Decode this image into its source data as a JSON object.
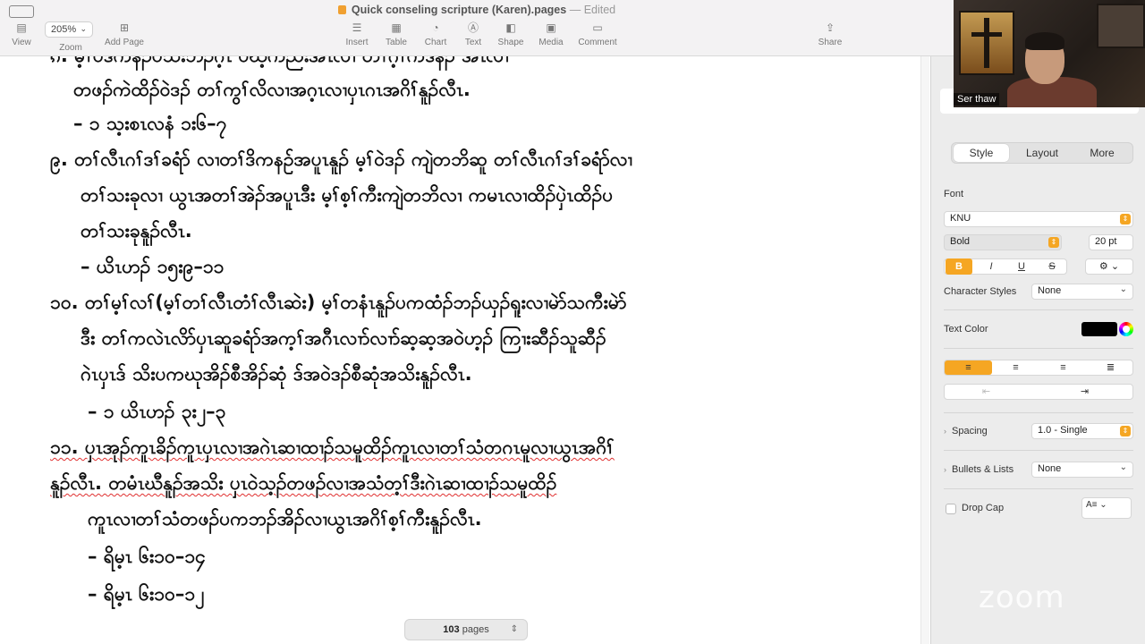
{
  "window": {
    "title": "Quick conseling scripture (Karen).pages",
    "status": "Edited",
    "separator": "—"
  },
  "toolbar": {
    "view_label": "View",
    "zoom_value": "205%",
    "zoom_label": "Zoom",
    "add_page_label": "Add Page",
    "insert_label": "Insert",
    "table_label": "Table",
    "chart_label": "Chart",
    "text_label": "Text",
    "shape_label": "Shape",
    "media_label": "Media",
    "comment_label": "Comment",
    "share_label": "Share"
  },
  "document": {
    "lines": [
      {
        "text": "ၵ. မ့ၢ်ပဒိကနဲၣ်ပသးဘၣ်ဂ့ၤ ပဃ့ကညးအီၤလၢ တၢ်ဂ့ၢ်ကိဒံနဲၣ် အီၤလၢ",
        "squiggle": false
      },
      {
        "text": "တဖၣ်ကဲထိၣ်ဝဲဒၣ် တၢ်ကွၢ်လိလၢအဂ့ၤလၢပှၤဂၤအဂိၢ်နူၣ်လီၤ.",
        "squiggle": false
      },
      {
        "text": "– ၁ သ့းစၤလနံ ၁း၆–၇",
        "squiggle": false
      },
      {
        "text": "၉. တၢ်လီၤဂၢ်ဒၢ်ခရံာ် လၢတၢ်ဒိကနဉ်အပူၤနူၣ် မ့ၢ်ဝဲဒၣ် ကျဲတဘိဆူ တၢ်လီၤဂၢ်ဒၢ်ခရံာ်လၢ",
        "squiggle": false
      },
      {
        "text": "တၢ်သးခုလၢ ယွၤအတၢ်အဲၣ်အပူၤဒီး မ့ၢ်စ့ၢ်ကီးကျဲတဘိလၢ ကမၤလၢထိၣ်ပှဲၤထိၣ်ပ",
        "squiggle": false
      },
      {
        "text": "တၢ်သးခုနူၣ်လီၤ.",
        "squiggle": false
      },
      {
        "text": "– ယိၤဟၣ် ၁၅း၉–၁၁",
        "squiggle": false
      },
      {
        "text": "၁၀. တၢ်မ့ၢ်လၢ်(မ့ၢ်တၢ်လီၤတံၢ်လီၤဆဲး) မ့ၢ်တနံၤနူၣ်ပကထံၣ်ဘၣ်ယှၣ်ရူးလၢမဲာ်သကီးမဲာ်",
        "squiggle": false
      },
      {
        "text": "ဒီး တၢ်ကလဲၤလိာ်ပှၤဆူခရံာ်အက့ၢ်အဂီၤလၢာ်လၢာ်ဆ့ဆ့အဝဲဟ့ၣ် ကြၢးဆီၣ်သူဆီၣ်",
        "squiggle": false
      },
      {
        "text": "ဂဲၤပှၤဒ် သိးပကဃုအိၣ်စီအိၣ်ဆုံ ဒ်အဝဲဒၣ်စီဆုံအသိးနူၣ်လီၤ.",
        "squiggle": false
      },
      {
        "text": "– ၁ ယိၤဟၣ် ၃း၂–၃",
        "squiggle": false
      },
      {
        "text": "၁၁. ပှၤအုၣ်ကူၤခိၣ်ကူၤပှၤလၢအဂဲၤဆၢထၢၣ်သမူထိၣ်ကူၤလၢတၢ်သံတဂၤမူလၢယွၤအဂိၢ်",
        "squiggle": true
      },
      {
        "text": "နူၣ်လီၤ. တမံၤဃီနူၣ်အသိး ပှၤဝဲသ့ၣ်တဖၣ်လၢအသံတ့ၢ်ဒီးဂဲၤဆၢထၢၣ်သမူထိၣ်",
        "squiggle": true
      },
      {
        "text": "ကူၤလၢတၢ်သံတဖၣ်ပကဘၣ်အိၣ်လၢယွၤအဂိၢ်စ့ၢ်ကီးနူၣ်လီၤ.",
        "squiggle": false
      },
      {
        "text": "– ရိမ့ၤ ၆း၁၀–၁၄",
        "squiggle": false
      },
      {
        "text": "– ရိမ့ၤ ၆း၁၀–၁၂",
        "squiggle": false
      }
    ],
    "pages_count": "103",
    "pages_label": "pages"
  },
  "sidebar": {
    "tabs": [
      "Style",
      "Layout",
      "More"
    ],
    "active_tab": "Style",
    "font_label": "Font",
    "font_name": "KNU",
    "font_style": "Bold",
    "font_size": "20 pt",
    "format_buttons": [
      "B",
      "I",
      "U",
      "S"
    ],
    "character_styles_label": "Character Styles",
    "character_styles_value": "None",
    "text_color_label": "Text Color",
    "text_color": "#000000",
    "spacing_label": "Spacing",
    "spacing_value": "1.0 - Single",
    "bullets_label": "Bullets & Lists",
    "bullets_value": "None",
    "drop_cap_label": "Drop Cap"
  },
  "video": {
    "participant_name": "Ser thaw",
    "watermark": "zoom"
  }
}
